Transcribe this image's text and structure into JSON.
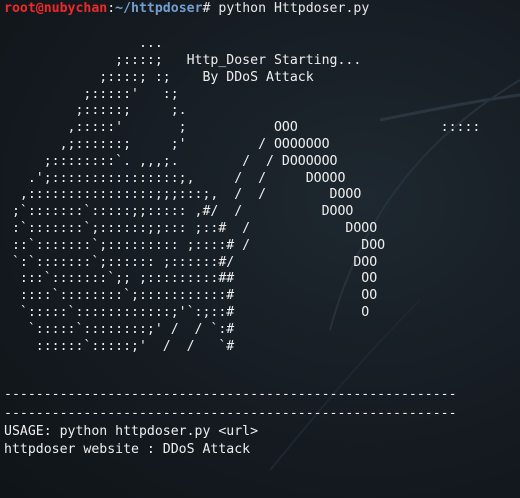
{
  "prompt": {
    "user_host": "root@nubychan",
    "separator": ":",
    "path": "~/httpdoser",
    "symbol": "# ",
    "command": "python Httpdoser.py"
  },
  "banner_art": "                 ...\n              ;::::;   Http_Doser Starting...\n            ;::::; :;    By DDoS Attack\n          ;:::::'   :;\n         ;:::::;     ;.\n        ,:::::'       ;           OOO                  :::::\n       ,;::::::;     ;'         / OOOOOOO\n     ;::::::::`. ,,,;.        /  / DOOOOOO\n   .';::::::::::::::::;,     /  /     DOOOO\n  ,::::::::::::::::;;;:::;,  /  /        DOOO\n ;`:::::::`:::::;;::::: ,#/  /          DOOO\n :`:::::::`;::::::;;::: ;::#  /            DOOO\n ::`:::::::`;::::::::: ;::::# /              DOO\n `:`:::::::`;:::::: ;::::::#/               DOO\n  :::`:::::::`;; ;:::::::::##                OO\n  ::::`::::::::`;:::::::::::#                OO\n  `:::::`::::::::::::;'`:;::#                O\n   `:::::`::::::::;' /  / `:#\n    ::::::`:::::;'  /  /   `#",
  "footer": {
    "divider_1": "---------------------------------------------------------",
    "divider_2": "---------------------------------------------------------",
    "usage": "USAGE: python httpdoser.py <url>",
    "website": "httpdoser website : DDoS Attack"
  }
}
